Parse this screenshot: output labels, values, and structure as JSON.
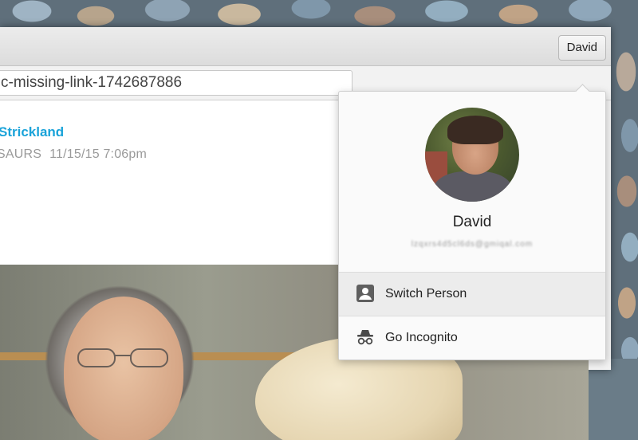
{
  "window": {
    "profile_button_label": "David",
    "url": "c-missing-link-1742687886"
  },
  "article": {
    "author": "Strickland",
    "section": "SAURS",
    "timestamp": "11/15/15 7:06pm"
  },
  "profile_menu": {
    "name": "David",
    "email": "lzqxrs4d5cl6ds@gmiqal.com",
    "items": [
      {
        "label": "Switch Person",
        "icon": "person-icon"
      },
      {
        "label": "Go Incognito",
        "icon": "incognito-icon"
      }
    ]
  }
}
